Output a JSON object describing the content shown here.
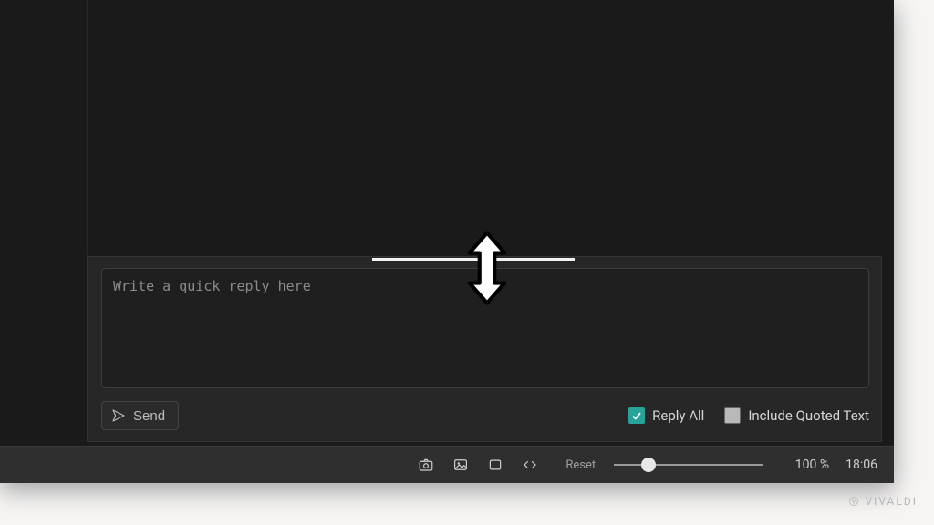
{
  "reply": {
    "placeholder": "Write a quick reply here",
    "send_label": "Send",
    "reply_all_label": "Reply All",
    "reply_all_checked": true,
    "include_quoted_label": "Include Quoted Text",
    "include_quoted_checked": false
  },
  "statusbar": {
    "reset_label": "Reset",
    "zoom_label": "100 %",
    "clock": "18:06",
    "icons": {
      "screenshot": "camera-icon",
      "image_toggle": "image-icon",
      "panel_toggle": "rectangle-icon",
      "devtools": "code-icon"
    }
  },
  "brand": {
    "name": "VIVALDI"
  }
}
